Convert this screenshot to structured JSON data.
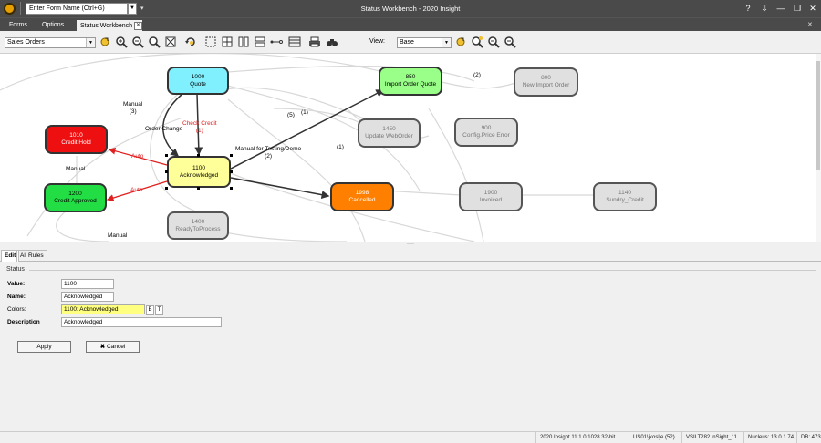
{
  "titlebar": {
    "form_search_placeholder": "Enter Form Name (Ctrl+G)",
    "title": "Status Workbench - 2020 Insight",
    "controls": [
      "?",
      "⇩",
      "—",
      "❐",
      "✕"
    ]
  },
  "menu": {
    "items": [
      "Forms",
      "Options"
    ],
    "active_tab": "Status Workbench"
  },
  "toolbar": {
    "entity_select": "Sales Orders",
    "view_label": "View:",
    "view_select": "Base"
  },
  "diagram": {
    "nodes": [
      {
        "id": "1000",
        "name": "Quote",
        "color": "#80f0ff"
      },
      {
        "id": "1010",
        "name": "Credit Hold",
        "color": "#ee1010"
      },
      {
        "id": "1100",
        "name": "Acknowledged",
        "color": "#ffff99"
      },
      {
        "id": "1200",
        "name": "Credit Approved",
        "color": "#22dd44"
      },
      {
        "id": "1400",
        "name": "ReadyToProcess",
        "color": "#e0e0e0"
      },
      {
        "id": "850",
        "name": "Import Order Quote",
        "color": "#99ff88"
      },
      {
        "id": "800",
        "name": "New Import Order",
        "color": "#e0e0e0"
      },
      {
        "id": "1450",
        "name": "Update WebOrder",
        "color": "#e0e0e0"
      },
      {
        "id": "900",
        "name": "Config.Price Error",
        "color": "#e0e0e0"
      },
      {
        "id": "1998",
        "name": "Cancelled",
        "color": "#ff8000"
      },
      {
        "id": "1900",
        "name": "Invoiced",
        "color": "#e0e0e0"
      },
      {
        "id": "1140",
        "name": "Sundry_Credit",
        "color": "#e0e0e0"
      }
    ],
    "labels": {
      "manual_3": "Manual\n(3)",
      "order_change": "Order Change",
      "check_credit": "Check Credit\n(1)",
      "manual_testing": "Manual for Testing/Demo\n(2)",
      "manual": "Manual",
      "auto_1": "Auto",
      "auto_2": "Auto",
      "num_5": "(5)",
      "num_1a": "(1)",
      "num_1b": "(1)",
      "num_2": "(2)",
      "manual_bottom": "Manual"
    }
  },
  "edit_tabs": [
    "Edit",
    "All Rules"
  ],
  "status_form": {
    "group": "Status",
    "value_label": "Value:",
    "value": "1100",
    "name_label": "Name:",
    "name": "Acknowledged",
    "colors_label": "Colors:",
    "colors_value": "1100: Acknowledged",
    "colors_btn_b": "B",
    "colors_btn_t": "T",
    "description_label": "Description",
    "description": "Acknowledged",
    "apply_label": "Apply",
    "cancel_label": "Cancel",
    "highlight_color": "#ffff80"
  },
  "statusbar": {
    "version": "2020 Insight 11.1.0.1028 32-bit",
    "user": "US01\\jkoslje (52)",
    "server": "VSILT282.inSight_11",
    "nucleus": "Nucleus: 13.0.1.74",
    "db": "DB: 473"
  }
}
